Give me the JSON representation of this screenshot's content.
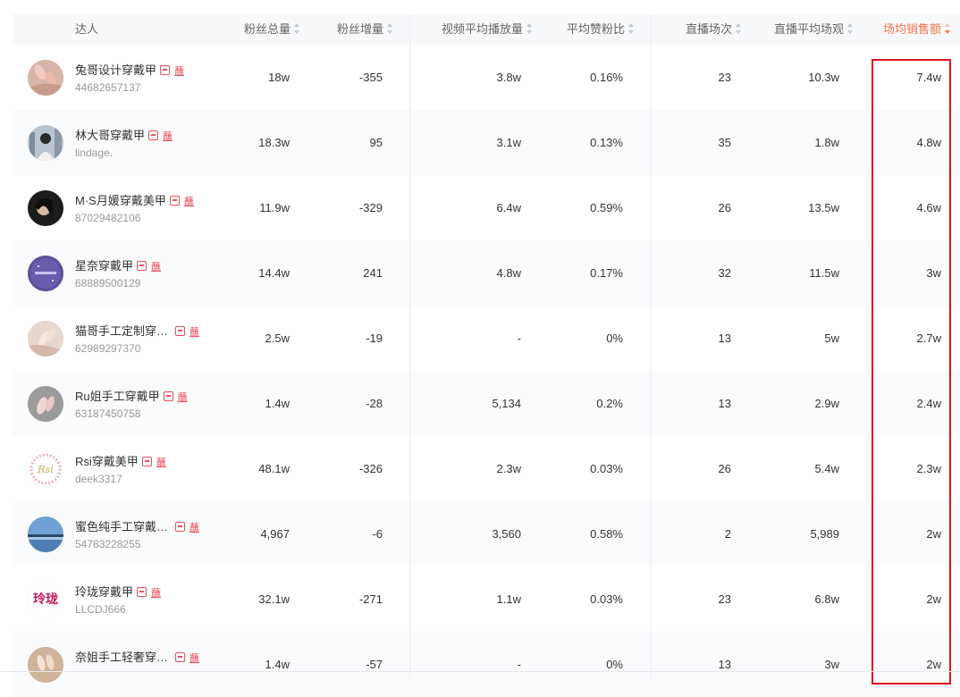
{
  "columns": [
    {
      "key": "influencer",
      "label": "达人",
      "sortable": false
    },
    {
      "key": "followers_total",
      "label": "粉丝总量",
      "sortable": true
    },
    {
      "key": "followers_growth",
      "label": "粉丝增量",
      "sortable": true
    },
    {
      "key": "video_avg_plays",
      "label": "视频平均播放量",
      "sortable": true
    },
    {
      "key": "avg_like_fan_ratio",
      "label": "平均赞粉比",
      "sortable": true
    },
    {
      "key": "live_sessions",
      "label": "直播场次",
      "sortable": true
    },
    {
      "key": "live_avg_viewers",
      "label": "直播平均场观",
      "sortable": true
    },
    {
      "key": "avg_sales_per_session",
      "label": "场均销售额",
      "sortable": true,
      "active": true,
      "sort": "desc"
    }
  ],
  "badge_text": "🛍",
  "badge_label": "蘸",
  "rows": [
    {
      "name": "兔哥设计穿戴甲",
      "uid": "44682657137",
      "followers_total": "18w",
      "followers_growth": "-355",
      "video_avg_plays": "3.8w",
      "avg_like_fan_ratio": "0.16%",
      "live_sessions": "23",
      "live_avg_viewers": "10.3w",
      "avg_sales_per_session": "7.4w",
      "avatar": "nails-pink"
    },
    {
      "name": "林大哥穿戴甲",
      "uid": "lindage.",
      "followers_total": "18.3w",
      "followers_growth": "95",
      "video_avg_plays": "3.1w",
      "avg_like_fan_ratio": "0.13%",
      "live_sessions": "35",
      "live_avg_viewers": "1.8w",
      "avg_sales_per_session": "4.8w",
      "avatar": "city-portrait"
    },
    {
      "name": "M·S月媛穿戴美甲",
      "uid": "87029482106",
      "followers_total": "11.9w",
      "followers_growth": "-329",
      "video_avg_plays": "6.4w",
      "avg_like_fan_ratio": "0.59%",
      "live_sessions": "26",
      "live_avg_viewers": "13.5w",
      "avg_sales_per_session": "4.6w",
      "avatar": "dark-portrait"
    },
    {
      "name": "星奈穿戴甲",
      "uid": "68889500129",
      "followers_total": "14.4w",
      "followers_growth": "241",
      "video_avg_plays": "4.8w",
      "avg_like_fan_ratio": "0.17%",
      "live_sessions": "32",
      "live_avg_viewers": "11.5w",
      "avg_sales_per_session": "3w",
      "avatar": "purple-logo"
    },
    {
      "name": "猫哥手工定制穿…",
      "uid": "62989297370",
      "followers_total": "2.5w",
      "followers_growth": "-19",
      "video_avg_plays": "-",
      "avg_like_fan_ratio": "0%",
      "live_sessions": "13",
      "live_avg_viewers": "5w",
      "avg_sales_per_session": "2.7w",
      "avatar": "nails-beige"
    },
    {
      "name": "Ru姐手工穿戴甲",
      "uid": "63187450758",
      "followers_total": "1.4w",
      "followers_growth": "-28",
      "video_avg_plays": "5,134",
      "avg_like_fan_ratio": "0.2%",
      "live_sessions": "13",
      "live_avg_viewers": "2.9w",
      "avg_sales_per_session": "2.4w",
      "avatar": "nails-gray"
    },
    {
      "name": "Rsi穿戴美甲",
      "uid": "deek3317",
      "followers_total": "48.1w",
      "followers_growth": "-326",
      "video_avg_plays": "2.3w",
      "avg_like_fan_ratio": "0.03%",
      "live_sessions": "26",
      "live_avg_viewers": "5.4w",
      "avg_sales_per_session": "2.3w",
      "avatar": "rsi-wreath"
    },
    {
      "name": "蜜色纯手工穿戴…",
      "uid": "54783228255",
      "followers_total": "4,967",
      "followers_growth": "-6",
      "video_avg_plays": "3,560",
      "avg_like_fan_ratio": "0.58%",
      "live_sessions": "2",
      "live_avg_viewers": "5,989",
      "avg_sales_per_session": "2w",
      "avatar": "sky-bridge"
    },
    {
      "name": "玲珑穿戴甲",
      "uid": "LLCDJ666",
      "followers_total": "32.1w",
      "followers_growth": "-271",
      "video_avg_plays": "1.1w",
      "avg_like_fan_ratio": "0.03%",
      "live_sessions": "23",
      "live_avg_viewers": "6.8w",
      "avg_sales_per_session": "2w",
      "avatar": "linglong-text",
      "avatar_text": "玲珑"
    },
    {
      "name": "奈姐手工轻奢穿…",
      "uid": "",
      "followers_total": "1.4w",
      "followers_growth": "-57",
      "video_avg_plays": "-",
      "avg_like_fan_ratio": "0%",
      "live_sessions": "13",
      "live_avg_viewers": "3w",
      "avg_sales_per_session": "2w",
      "avatar": "nails-warm"
    }
  ]
}
